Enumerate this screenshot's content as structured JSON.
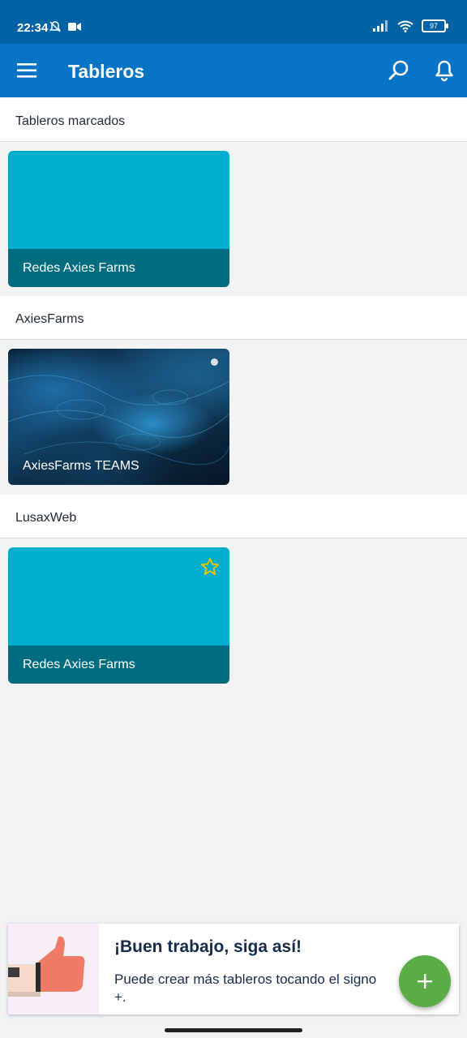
{
  "status": {
    "time": "22:34",
    "battery": "97"
  },
  "appbar": {
    "title": "Tableros"
  },
  "sections": [
    {
      "header": "Tableros marcados",
      "board": "Redes Axies Farms"
    },
    {
      "header": "AxiesFarms",
      "board": "AxiesFarms TEAMS"
    },
    {
      "header": "LusaxWeb",
      "board": "Redes Axies Farms"
    }
  ],
  "banner": {
    "title": "¡Buen trabajo, siga así!",
    "body": "Puede crear más tableros tocando el signo +."
  },
  "colors": {
    "statusbar": "#0262a6",
    "appbar": "#0874c6",
    "board_top": "#00aecf",
    "board_bottom": "#006c80",
    "fab": "#5aac44",
    "star": "#e2c40a"
  },
  "icons": [
    "menu-icon",
    "search-icon",
    "bell-icon",
    "star-icon",
    "plus-icon",
    "thumbs-up-illustration"
  ]
}
